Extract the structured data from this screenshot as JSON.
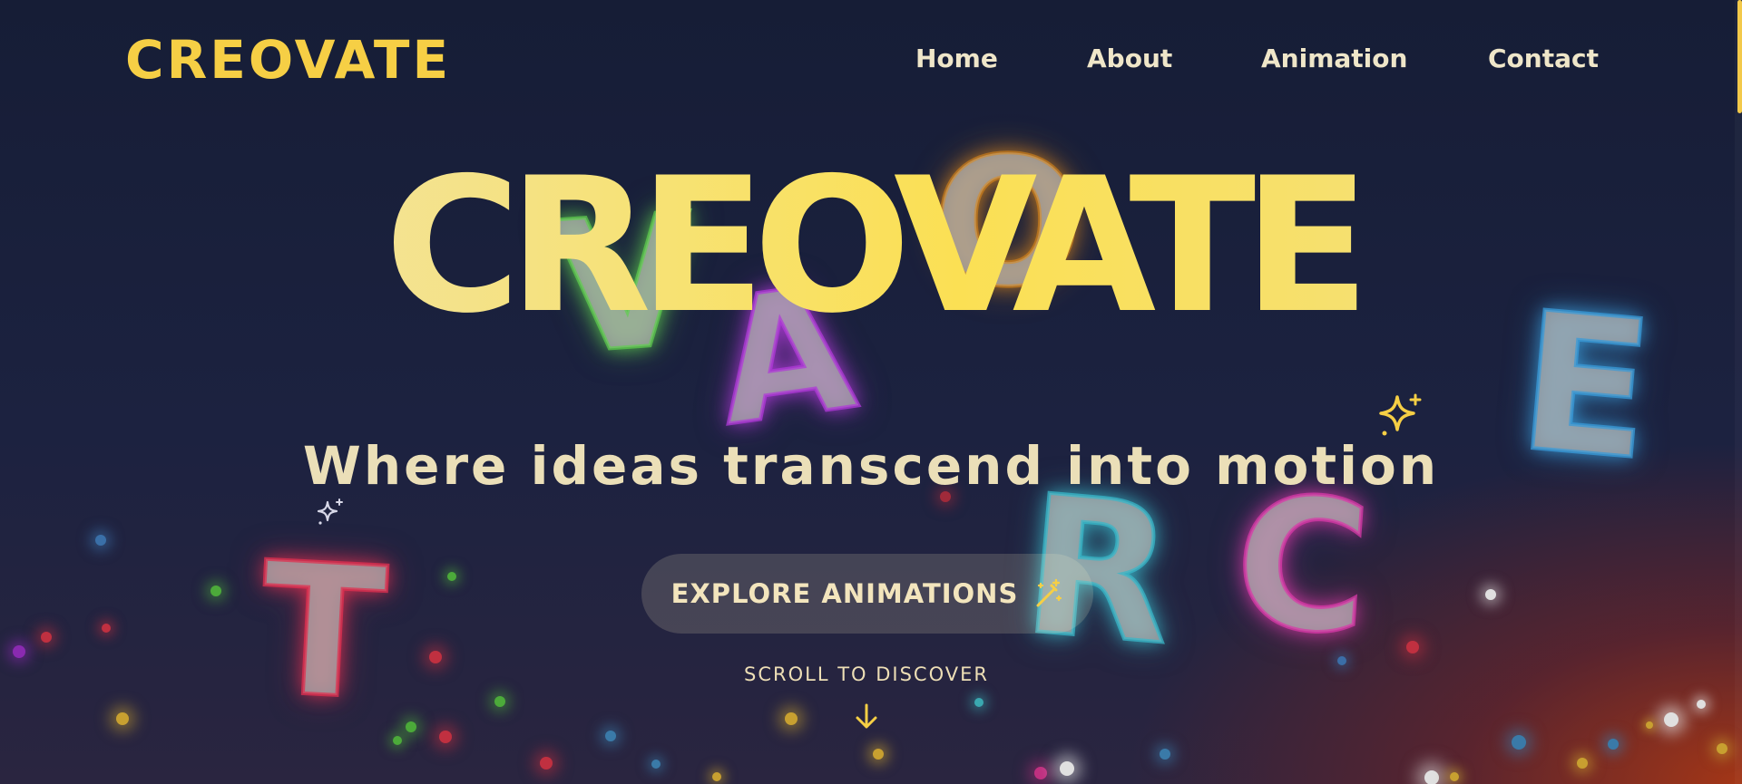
{
  "brand": {
    "logo": "CREOVATE"
  },
  "nav": {
    "items": [
      "Home",
      "About",
      "Animation",
      "Contact"
    ]
  },
  "hero": {
    "title": "CREOVATE",
    "subtitle": "Where ideas transcend into motion",
    "cta_label": "EXPLORE ANIMATIONS",
    "cta_icon": "magic-wand-icon",
    "scroll_hint": "SCROLL TO DISCOVER",
    "scroll_icon": "arrow-down-icon"
  },
  "floating_letters": [
    {
      "char": "V",
      "glow": "#5fcf4e"
    },
    {
      "char": "A",
      "glow": "#b03ad8"
    },
    {
      "char": "O",
      "glow": "#e08a1a"
    },
    {
      "char": "E",
      "glow": "#3a9bd8"
    },
    {
      "char": "R",
      "glow": "#3ab7c8"
    },
    {
      "char": "C",
      "glow": "#d83aa8"
    },
    {
      "char": "T",
      "glow": "#e03050"
    }
  ],
  "colors": {
    "accent": "#f6cf45",
    "background_top": "#161d36",
    "background_glow": "#aa3714",
    "text_light": "#efe6c9"
  }
}
